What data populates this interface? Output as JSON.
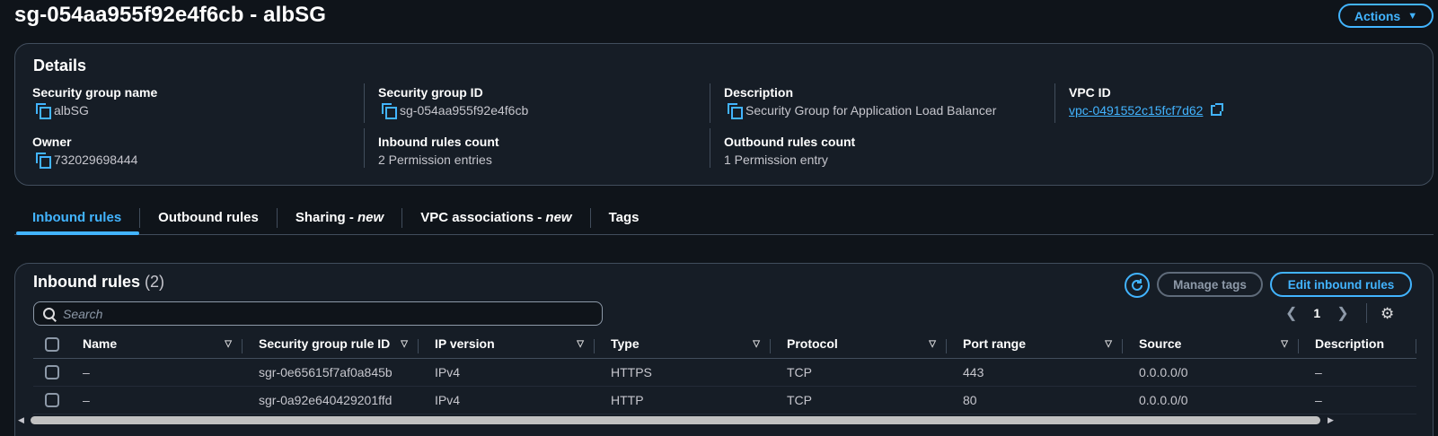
{
  "header": {
    "title": "sg-054aa955f92e4f6cb - albSG",
    "actions_label": "Actions"
  },
  "details": {
    "heading": "Details",
    "fields": [
      {
        "label": "Security group name",
        "value": "albSG"
      },
      {
        "label": "Security group ID",
        "value": "sg-054aa955f92e4f6cb"
      },
      {
        "label": "Description",
        "value": "Security Group for Application Load Balancer"
      },
      {
        "label": "VPC ID",
        "value": "vpc-0491552c15fcf7d62"
      },
      {
        "label": "Owner",
        "value": "732029698444"
      },
      {
        "label": "Inbound rules count",
        "value": "2 Permission entries"
      },
      {
        "label": "Outbound rules count",
        "value": "1 Permission entry"
      }
    ]
  },
  "tabs": [
    {
      "label": "Inbound rules",
      "suffix": ""
    },
    {
      "label": "Outbound rules",
      "suffix": ""
    },
    {
      "label": "Sharing - ",
      "suffix": "new"
    },
    {
      "label": "VPC associations - ",
      "suffix": "new"
    },
    {
      "label": "Tags",
      "suffix": ""
    }
  ],
  "rules": {
    "title": "Inbound rules",
    "count": "(2)",
    "manage_tags": "Manage tags",
    "edit": "Edit inbound rules",
    "search_placeholder": "Search",
    "page": "1",
    "columns": [
      "Name",
      "Security group rule ID",
      "IP version",
      "Type",
      "Protocol",
      "Port range",
      "Source",
      "Description"
    ],
    "rows": [
      [
        "–",
        "sgr-0e65615f7af0a845b",
        "IPv4",
        "HTTPS",
        "TCP",
        "443",
        "0.0.0.0/0",
        "–"
      ],
      [
        "–",
        "sgr-0a92e640429201ffd",
        "IPv4",
        "HTTP",
        "TCP",
        "80",
        "0.0.0.0/0",
        "–"
      ]
    ]
  },
  "colors": {
    "accent": "#42b4ff",
    "background": "#0f141a",
    "panel": "#161d26"
  },
  "icons": [
    "copy-icon",
    "external-link-icon",
    "refresh-icon",
    "search-icon",
    "chevron-left-icon",
    "chevron-right-icon",
    "gear-icon",
    "sort-icon",
    "caret-down-icon"
  ]
}
